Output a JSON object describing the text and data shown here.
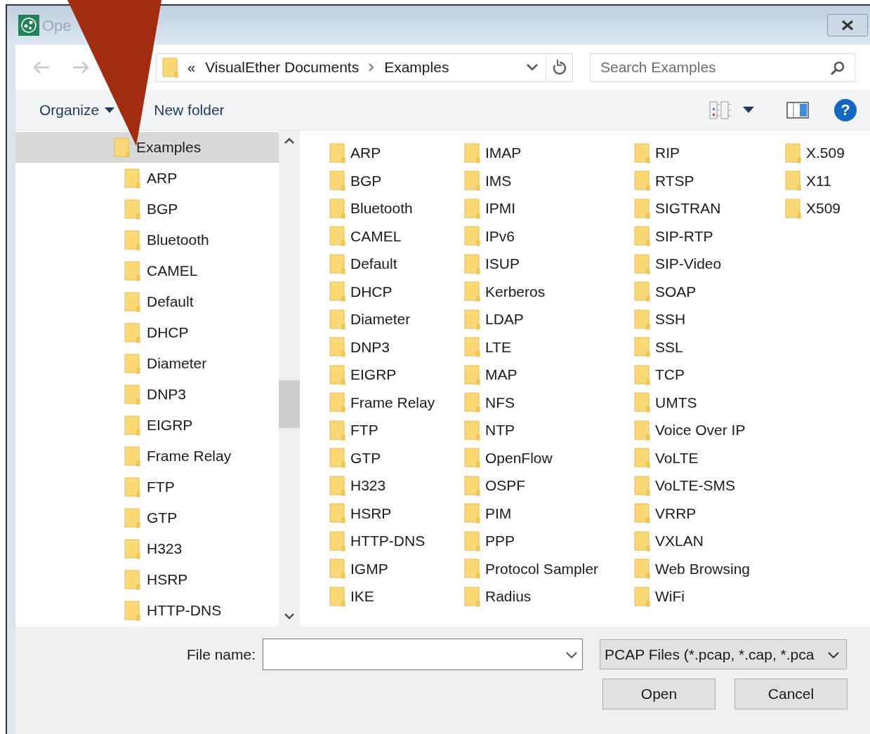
{
  "window": {
    "title": "Ope"
  },
  "nav": {
    "breadcrumb_overflow": "«",
    "breadcrumb": [
      "VisualEther Documents",
      "Examples"
    ],
    "search": {
      "placeholder": "Search Examples"
    }
  },
  "toolbar": {
    "organize": "Organize",
    "new_folder": "New folder",
    "help": "?"
  },
  "sidebar": {
    "items": [
      {
        "label": "Examples",
        "selected": true,
        "children": [
          {
            "label": "ARP",
            "selected": false
          },
          {
            "label": "BGP",
            "selected": false
          },
          {
            "label": "Bluetooth",
            "selected": false
          },
          {
            "label": "CAMEL",
            "selected": false
          },
          {
            "label": "Default",
            "selected": false
          },
          {
            "label": "DHCP",
            "selected": false
          },
          {
            "label": "Diameter",
            "selected": false
          },
          {
            "label": "DNP3",
            "selected": false
          },
          {
            "label": "EIGRP",
            "selected": false
          },
          {
            "label": "Frame Relay",
            "selected": false
          },
          {
            "label": "FTP",
            "selected": false
          },
          {
            "label": "GTP",
            "selected": false
          },
          {
            "label": "H323",
            "selected": false
          },
          {
            "label": "HSRP",
            "selected": false
          },
          {
            "label": "HTTP-DNS",
            "selected": false
          }
        ]
      }
    ]
  },
  "folders": [
    "ARP",
    "BGP",
    "Bluetooth",
    "CAMEL",
    "Default",
    "DHCP",
    "Diameter",
    "DNP3",
    "EIGRP",
    "Frame Relay",
    "FTP",
    "GTP",
    "H323",
    "HSRP",
    "HTTP-DNS",
    "IGMP",
    "IKE",
    "IMAP",
    "IMS",
    "IPMI",
    "IPv6",
    "ISUP",
    "Kerberos",
    "LDAP",
    "LTE",
    "MAP",
    "NFS",
    "NTP",
    "OpenFlow",
    "OSPF",
    "PIM",
    "PPP",
    "Protocol Sampler",
    "Radius",
    "RIP",
    "RTSP",
    "SIGTRAN",
    "SIP-RTP",
    "SIP-Video",
    "SOAP",
    "SSH",
    "SSL",
    "TCP",
    "UMTS",
    "Voice Over IP",
    "VoLTE",
    "VoLTE-SMS",
    "VRRP",
    "VXLAN",
    "Web Browsing",
    "WiFi",
    "X.509",
    "X11",
    "X509"
  ],
  "footer": {
    "file_name_label": "File name:",
    "file_type": "PCAP Files (*.pcap, *.cap, *.pca",
    "buttons": [
      "Open",
      "Cancel"
    ]
  }
}
